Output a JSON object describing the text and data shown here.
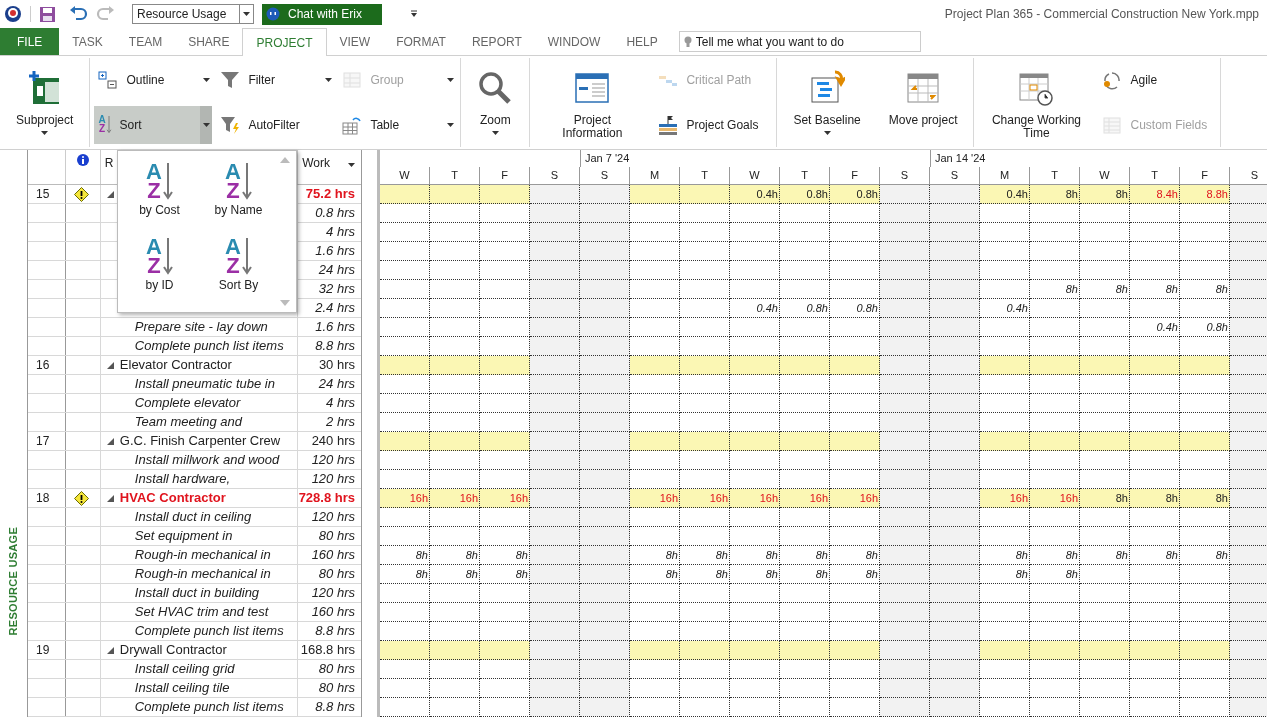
{
  "quick_access": {
    "view_combo": "Resource Usage",
    "chat_button": "Chat with Erix"
  },
  "window": {
    "title": "Project Plan 365 - Commercial Construction New York.mpp"
  },
  "tabs": [
    {
      "label": "FILE",
      "kind": "file",
      "selected": false
    },
    {
      "label": "TASK",
      "kind": "tab",
      "selected": false
    },
    {
      "label": "TEAM",
      "kind": "tab",
      "selected": false
    },
    {
      "label": "SHARE",
      "kind": "tab",
      "selected": false
    },
    {
      "label": "PROJECT",
      "kind": "tab",
      "selected": true
    },
    {
      "label": "VIEW",
      "kind": "tab",
      "selected": false
    },
    {
      "label": "FORMAT",
      "kind": "tab",
      "selected": false
    },
    {
      "label": "REPORT",
      "kind": "tab",
      "selected": false
    },
    {
      "label": "WINDOW",
      "kind": "tab",
      "selected": false
    },
    {
      "label": "HELP",
      "kind": "tab",
      "selected": false
    }
  ],
  "tell_me": {
    "placeholder": "Tell me what you want to do"
  },
  "ribbon": {
    "groups": [
      {
        "columns": [
          [
            {
              "kind": "large",
              "label": "Subproject",
              "dropdown": true,
              "disabled": false,
              "pressed": false
            }
          ]
        ]
      },
      {
        "columns": [
          [
            {
              "kind": "small",
              "label": "Outline",
              "dropdown": true,
              "disabled": false,
              "pressed": false
            },
            {
              "kind": "small",
              "label": "Sort",
              "dropdown": true,
              "disabled": false,
              "pressed": true,
              "glyph": [
                "A",
                "Z"
              ]
            }
          ],
          [
            {
              "kind": "small",
              "label": "Filter",
              "dropdown": true,
              "disabled": false,
              "pressed": false
            },
            {
              "kind": "small",
              "label": "AutoFilter",
              "dropdown": false,
              "disabled": false,
              "pressed": false
            }
          ],
          [
            {
              "kind": "small",
              "label": "Group",
              "dropdown": true,
              "disabled": true,
              "pressed": false
            },
            {
              "kind": "small",
              "label": "Table",
              "dropdown": true,
              "disabled": false,
              "pressed": false
            }
          ]
        ]
      },
      {
        "columns": [
          [
            {
              "kind": "large",
              "label": "Zoom",
              "dropdown": true,
              "disabled": false,
              "pressed": false
            }
          ]
        ]
      },
      {
        "columns": [
          [
            {
              "kind": "large",
              "label": "Project Information",
              "dropdown": false,
              "disabled": false,
              "pressed": false
            }
          ],
          [
            {
              "kind": "small",
              "label": "Critical Path",
              "dropdown": false,
              "disabled": true,
              "pressed": false
            },
            {
              "kind": "small",
              "label": "Project Goals",
              "dropdown": false,
              "disabled": false,
              "pressed": false
            }
          ]
        ]
      },
      {
        "columns": [
          [
            {
              "kind": "large",
              "label": "Set Baseline",
              "dropdown": true,
              "disabled": false,
              "pressed": false
            }
          ],
          [
            {
              "kind": "large",
              "label": "Move project",
              "dropdown": false,
              "disabled": false,
              "pressed": false
            }
          ]
        ]
      },
      {
        "columns": [
          [
            {
              "kind": "large",
              "label": "Change Working Time",
              "dropdown": false,
              "disabled": false,
              "pressed": false
            }
          ],
          [
            {
              "kind": "small",
              "label": "Agile",
              "dropdown": false,
              "disabled": false,
              "pressed": false
            },
            {
              "kind": "small",
              "label": "Custom Fields",
              "dropdown": false,
              "disabled": true,
              "pressed": false
            }
          ]
        ]
      }
    ]
  },
  "sort_menu": {
    "items": [
      {
        "label": "by Cost",
        "glyph": [
          "A",
          "Z"
        ]
      },
      {
        "label": "by Name",
        "glyph": [
          "A",
          "Z"
        ]
      },
      {
        "label": "by ID",
        "glyph": [
          "A",
          "Z"
        ]
      },
      {
        "label": "Sort By",
        "glyph": [
          "A",
          "Z"
        ]
      }
    ]
  },
  "side_label": "RESOURCE USAGE",
  "table": {
    "name_header": "R",
    "work_header": "Work"
  },
  "timescale": {
    "weeks": [
      {
        "label": "Jan 7 '24"
      },
      {
        "label": "Jan 14 '24"
      }
    ],
    "days": [
      {
        "label": "W",
        "weekend": false
      },
      {
        "label": "T",
        "weekend": false
      },
      {
        "label": "F",
        "weekend": false
      },
      {
        "label": "S",
        "weekend": true
      },
      {
        "label": "S",
        "weekend": true
      },
      {
        "label": "M",
        "weekend": false
      },
      {
        "label": "T",
        "weekend": false
      },
      {
        "label": "W",
        "weekend": false
      },
      {
        "label": "T",
        "weekend": false
      },
      {
        "label": "F",
        "weekend": false
      },
      {
        "label": "S",
        "weekend": true
      },
      {
        "label": "S",
        "weekend": true
      },
      {
        "label": "M",
        "weekend": false
      },
      {
        "label": "T",
        "weekend": false
      },
      {
        "label": "W",
        "weekend": false
      },
      {
        "label": "T",
        "weekend": false
      },
      {
        "label": "F",
        "weekend": false
      },
      {
        "label": "S",
        "weekend": true
      }
    ]
  },
  "resources": [
    {
      "id": "15",
      "overallocated": true,
      "expanded": true,
      "work": "75.2 hrs",
      "cells": [
        null,
        null,
        null,
        null,
        null,
        null,
        null,
        {
          "text": "0.4h",
          "over": false
        },
        {
          "text": "0.8h",
          "over": false
        },
        {
          "text": "0.8h",
          "over": false
        },
        null,
        null,
        {
          "text": "0.4h",
          "over": false
        },
        {
          "text": "8h",
          "over": false
        },
        {
          "text": "8h",
          "over": false
        },
        {
          "text": "8.4h",
          "over": true
        },
        {
          "text": "8.8h",
          "over": true
        },
        null
      ],
      "children": [
        {
          "work": "0.8 hrs"
        },
        {
          "work": "4 hrs"
        },
        {
          "work": "1.6 hrs"
        },
        {
          "work": "24 hrs"
        },
        {
          "work": "32 hrs",
          "cells": [
            null,
            null,
            null,
            null,
            null,
            null,
            null,
            null,
            null,
            null,
            null,
            null,
            null,
            {
              "text": "8h",
              "over": false
            },
            {
              "text": "8h",
              "over": false
            },
            {
              "text": "8h",
              "over": false
            },
            {
              "text": "8h",
              "over": false
            },
            null
          ]
        },
        {
          "work": "2.4 hrs",
          "cells": [
            null,
            null,
            null,
            null,
            null,
            null,
            null,
            {
              "text": "0.4h",
              "over": false
            },
            {
              "text": "0.8h",
              "over": false
            },
            {
              "text": "0.8h",
              "over": false
            },
            null,
            null,
            {
              "text": "0.4h",
              "over": false
            },
            null,
            null,
            null,
            null,
            null
          ]
        },
        {
          "name": "Prepare site - lay down",
          "work": "1.6 hrs",
          "cells": [
            null,
            null,
            null,
            null,
            null,
            null,
            null,
            null,
            null,
            null,
            null,
            null,
            null,
            null,
            null,
            {
              "text": "0.4h",
              "over": false
            },
            {
              "text": "0.8h",
              "over": false
            },
            null
          ]
        },
        {
          "name": "Complete punch list items",
          "work": "8.8 hrs"
        }
      ]
    },
    {
      "id": "16",
      "name": "Elevator Contractor",
      "overallocated": false,
      "expanded": true,
      "work": "30 hrs",
      "children": [
        {
          "name": "Install pneumatic tube in",
          "work": "24 hrs"
        },
        {
          "name": "Complete elevator",
          "work": "4 hrs"
        },
        {
          "name": "Team meeting and",
          "work": "2 hrs"
        }
      ]
    },
    {
      "id": "17",
      "name": "G.C. Finish Carpenter Crew",
      "overallocated": false,
      "expanded": true,
      "work": "240 hrs",
      "children": [
        {
          "name": "Install millwork and wood",
          "work": "120 hrs"
        },
        {
          "name": "Install hardware,",
          "work": "120 hrs"
        }
      ]
    },
    {
      "id": "18",
      "name": "HVAC Contractor",
      "overallocated": true,
      "expanded": true,
      "work": "728.8 hrs",
      "cells": [
        {
          "text": "16h",
          "over": true
        },
        {
          "text": "16h",
          "over": true
        },
        {
          "text": "16h",
          "over": true
        },
        null,
        null,
        {
          "text": "16h",
          "over": true
        },
        {
          "text": "16h",
          "over": true
        },
        {
          "text": "16h",
          "over": true
        },
        {
          "text": "16h",
          "over": true
        },
        {
          "text": "16h",
          "over": true
        },
        null,
        null,
        {
          "text": "16h",
          "over": true
        },
        {
          "text": "16h",
          "over": true
        },
        {
          "text": "8h",
          "over": false
        },
        {
          "text": "8h",
          "over": false
        },
        {
          "text": "8h",
          "over": false
        },
        null
      ],
      "children": [
        {
          "name": "Install duct in ceiling",
          "work": "120 hrs"
        },
        {
          "name": "Set equipment in",
          "work": "80 hrs"
        },
        {
          "name": "Rough-in mechanical in",
          "work": "160 hrs",
          "cells": [
            {
              "text": "8h",
              "over": false
            },
            {
              "text": "8h",
              "over": false
            },
            {
              "text": "8h",
              "over": false
            },
            null,
            null,
            {
              "text": "8h",
              "over": false
            },
            {
              "text": "8h",
              "over": false
            },
            {
              "text": "8h",
              "over": false
            },
            {
              "text": "8h",
              "over": false
            },
            {
              "text": "8h",
              "over": false
            },
            null,
            null,
            {
              "text": "8h",
              "over": false
            },
            {
              "text": "8h",
              "over": false
            },
            {
              "text": "8h",
              "over": false
            },
            {
              "text": "8h",
              "over": false
            },
            {
              "text": "8h",
              "over": false
            },
            null
          ]
        },
        {
          "name": "Rough-in mechanical in",
          "work": "80 hrs",
          "cells": [
            {
              "text": "8h",
              "over": false
            },
            {
              "text": "8h",
              "over": false
            },
            {
              "text": "8h",
              "over": false
            },
            null,
            null,
            {
              "text": "8h",
              "over": false
            },
            {
              "text": "8h",
              "over": false
            },
            {
              "text": "8h",
              "over": false
            },
            {
              "text": "8h",
              "over": false
            },
            {
              "text": "8h",
              "over": false
            },
            null,
            null,
            {
              "text": "8h",
              "over": false
            },
            {
              "text": "8h",
              "over": false
            },
            null,
            null,
            null,
            null
          ]
        },
        {
          "name": "Install duct in building",
          "work": "120 hrs"
        },
        {
          "name": "Set HVAC trim and test",
          "work": "160 hrs"
        },
        {
          "name": "Complete punch list items",
          "work": "8.8 hrs"
        }
      ]
    },
    {
      "id": "19",
      "name": "Drywall Contractor",
      "overallocated": false,
      "expanded": true,
      "work": "168.8 hrs",
      "children": [
        {
          "name": "Install ceiling grid",
          "work": "80 hrs"
        },
        {
          "name": "Install ceiling tile",
          "work": "80 hrs"
        },
        {
          "name": "Complete punch list items",
          "work": "8.8 hrs"
        }
      ]
    }
  ]
}
